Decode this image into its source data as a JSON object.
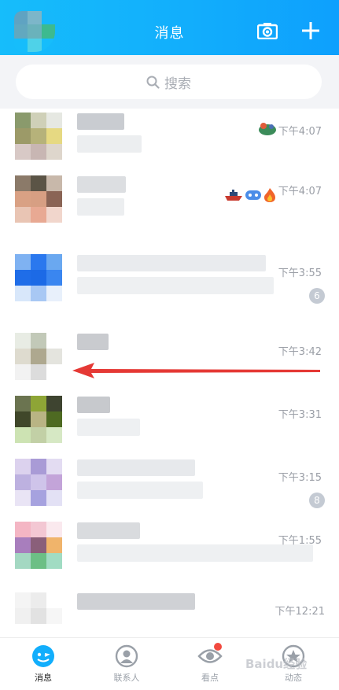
{
  "header": {
    "title": "消息",
    "gradient_start": "#16bdfb",
    "gradient_end": "#0ea0fd"
  },
  "search": {
    "placeholder": "搜索"
  },
  "conversations": [
    {
      "time": "下午4:07",
      "badge": ""
    },
    {
      "time": "下午4:07",
      "badge": ""
    },
    {
      "time": "下午3:55",
      "badge": "6"
    },
    {
      "time": "下午3:42",
      "badge": ""
    },
    {
      "time": "下午3:31",
      "badge": ""
    },
    {
      "time": "下午3:15",
      "badge": "8"
    },
    {
      "time": "下午1:55",
      "badge": ""
    },
    {
      "time": "下午12:21",
      "badge": ""
    }
  ],
  "nav": {
    "messages": "消息",
    "contacts": "联系人",
    "watch": "看点",
    "feeds": "动态"
  },
  "watermark": "Baidu经验",
  "colors": {
    "accent": "#12aefc",
    "arrow": "#e53935",
    "badge": "#c4cad3",
    "notification_dot": "#f24a3f"
  }
}
